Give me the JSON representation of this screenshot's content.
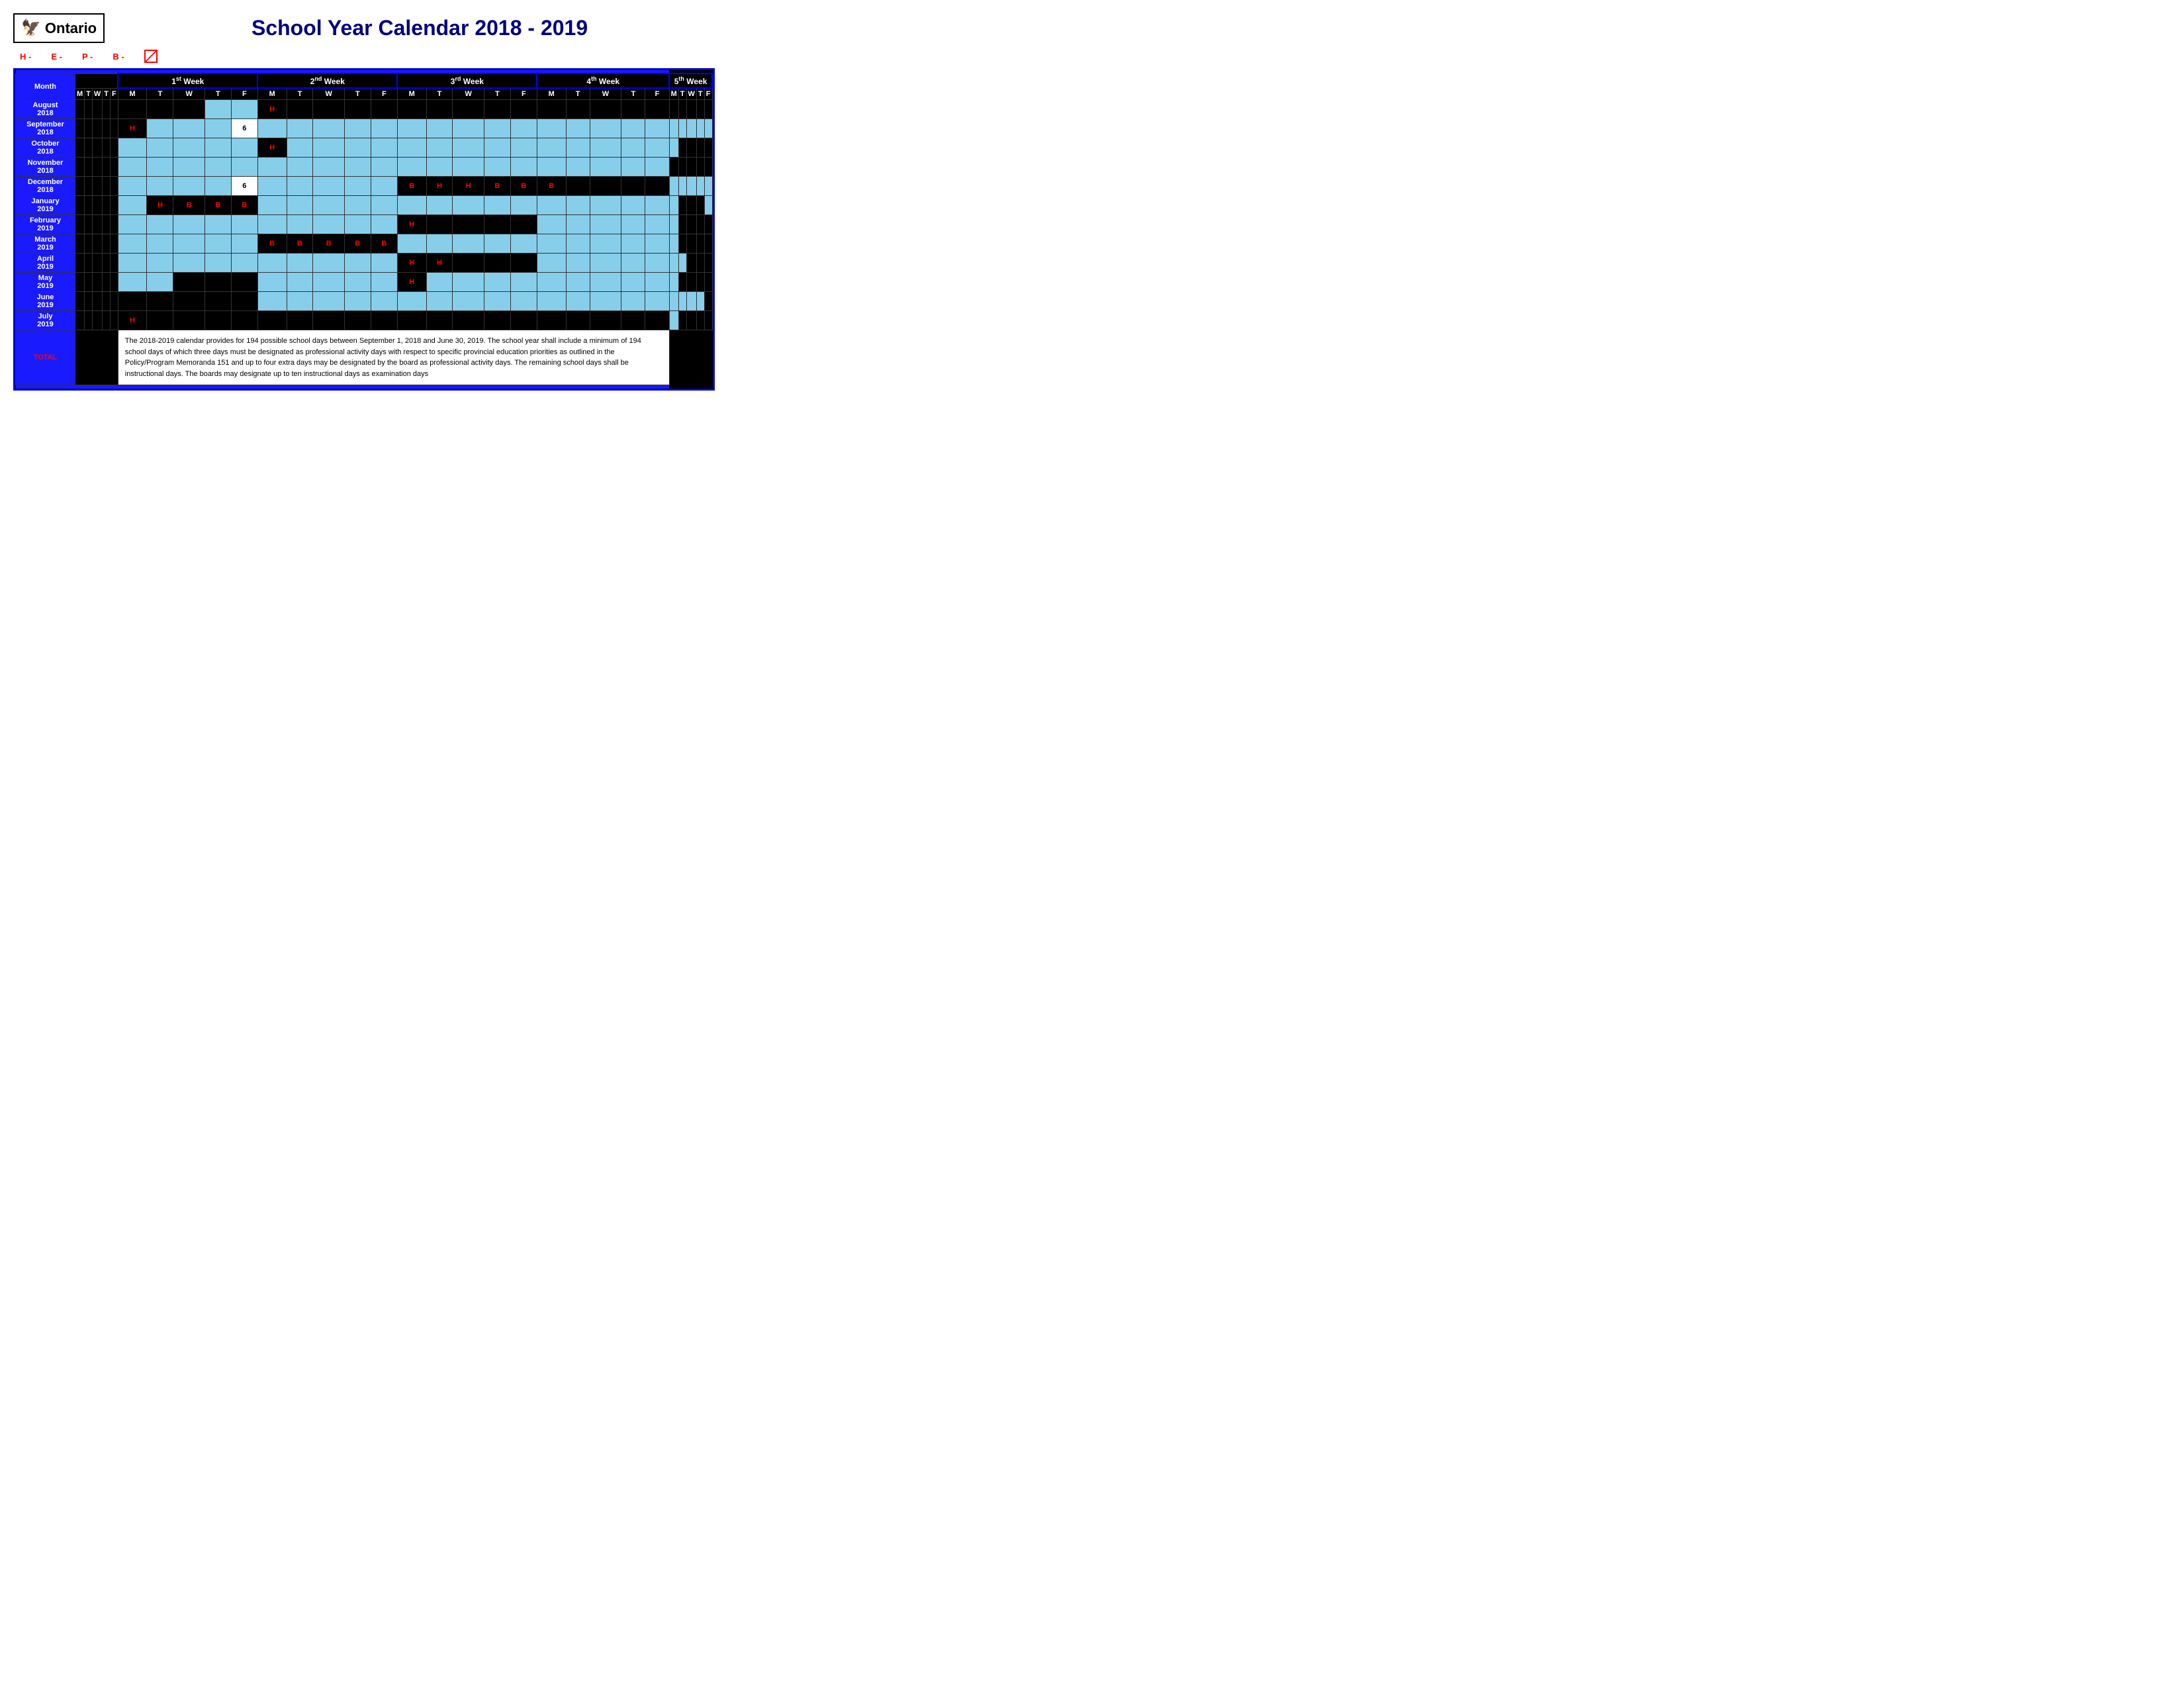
{
  "title": {
    "main": "School Year Calendar ",
    "year": "2018 - 2019"
  },
  "logo": {
    "text": "Ontario",
    "icon": "🦅"
  },
  "legend": {
    "items": [
      {
        "key": "H",
        "label": "H -"
      },
      {
        "key": "E",
        "label": "E -"
      },
      {
        "key": "P",
        "label": "P -"
      },
      {
        "key": "B",
        "label": "B -"
      }
    ]
  },
  "weeks": [
    {
      "label": "1",
      "sup": "st",
      "suffix": " Week"
    },
    {
      "label": "2",
      "sup": "nd",
      "suffix": " Week"
    },
    {
      "label": "3",
      "sup": "rd",
      "suffix": " Week"
    },
    {
      "label": "4",
      "sup": "th",
      "suffix": " Week"
    },
    {
      "label": "5",
      "sup": "th",
      "suffix": " Week"
    }
  ],
  "days": [
    "M",
    "T",
    "W",
    "T",
    "F",
    "M",
    "T",
    "W",
    "T",
    "F",
    "M",
    "T",
    "W",
    "T",
    "F",
    "M",
    "T",
    "W",
    "T",
    "F",
    "M",
    "T",
    "W",
    "T",
    "F"
  ],
  "months": [
    {
      "name": "August\n2018"
    },
    {
      "name": "September\n2018"
    },
    {
      "name": "October\n2018"
    },
    {
      "name": "November\n2018"
    },
    {
      "name": "December\n2018"
    },
    {
      "name": "January\n2019"
    },
    {
      "name": "February\n2019"
    },
    {
      "name": "March\n2019"
    },
    {
      "name": "April\n2019"
    },
    {
      "name": "May\n2019"
    },
    {
      "name": "June\n2019"
    },
    {
      "name": "July\n2019"
    }
  ],
  "total": {
    "label": "TOTAL",
    "note": "The 2018-2019 calendar provides for 194 possible school days between September 1, 2018 and June 30, 2019. The school year shall include a minimum of 194 school days of which three days must be designated as professional activity days with respect to specific provincial education priorities as outlined in the Policy/Program Memoranda 151 and up to four extra days may be designated by the board as professional activity days.  The remaining school days shall be instructional days.  The boards may designate up to ten instructional days as examination days"
  }
}
